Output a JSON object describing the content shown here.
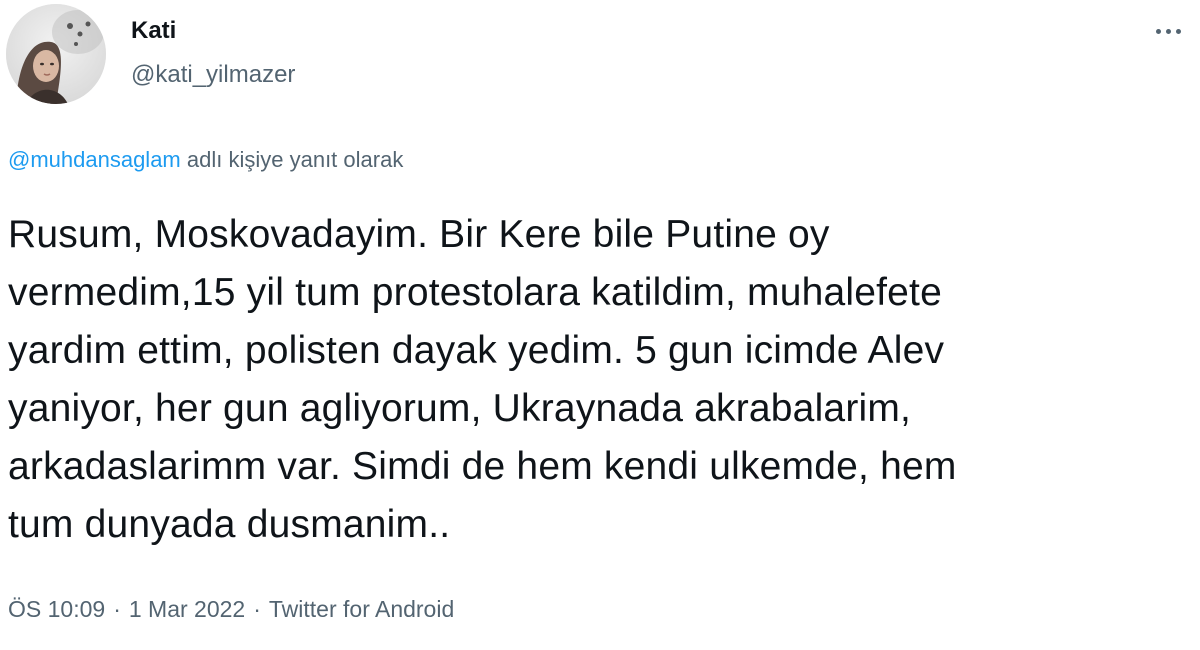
{
  "author": {
    "display_name": "Kati",
    "handle": "@kati_yilmazer",
    "avatar_icon": "profile-photo"
  },
  "menu": {
    "icon": "more-horizontal-icon"
  },
  "reply_context": {
    "target_handle": "@muhdansaglam",
    "suffix": "adlı kişiye yanıt olarak"
  },
  "tweet": {
    "text": "Rusum, Moskovadayim. Bir Kere bile Putine oy\nvermedim,15 yil tum protestolara katildim, muhalefete\nyardim ettim, polisten dayak yedim. 5 gun icimde Alev\nyaniyor, her gun agliyorum, Ukraynada akrabalarim,\narkadaslarimm var. Simdi de hem kendi ulkemde, hem\ntum dunyada dusmanim.."
  },
  "meta": {
    "time": "ÖS 10:09",
    "separator": "·",
    "date": "1 Mar 2022",
    "source": "Twitter for Android"
  },
  "colors": {
    "link": "#1d9bf0",
    "secondary_text": "#536471",
    "primary_text": "#0f1419"
  }
}
